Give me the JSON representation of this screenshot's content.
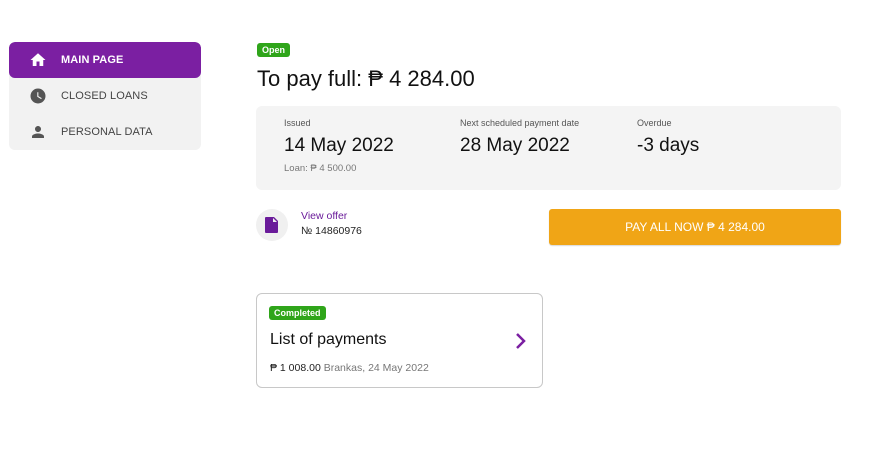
{
  "sidebar": {
    "items": [
      {
        "label": "MAIN PAGE",
        "icon": "home-icon",
        "active": true
      },
      {
        "label": "CLOSED LOANS",
        "icon": "clock-icon",
        "active": false
      },
      {
        "label": "PERSONAL DATA",
        "icon": "person-icon",
        "active": false
      }
    ]
  },
  "loan": {
    "status": "Open",
    "title": "To pay full: ₱ 4 284.00",
    "issued_label": "Issued",
    "issued_value": "14 May 2022",
    "loan_amount": "Loan: ₱ 4 500.00",
    "next_payment_label": "Next scheduled payment date",
    "next_payment_value": "28 May 2022",
    "overdue_label": "Overdue",
    "overdue_value": "-3 days"
  },
  "offer": {
    "link": "View offer",
    "number": "№ 14860976",
    "icon": "document-icon"
  },
  "pay_button": "PAY ALL NOW ₱ 4 284.00",
  "payments_card": {
    "status": "Completed",
    "title": "List of payments",
    "amount": "₱ 1 008.00",
    "detail": "Brankas, 24 May 2022"
  },
  "colors": {
    "accent": "#7b1fa2",
    "pay_button": "#f0a516",
    "badge_green": "#2fa51a"
  }
}
